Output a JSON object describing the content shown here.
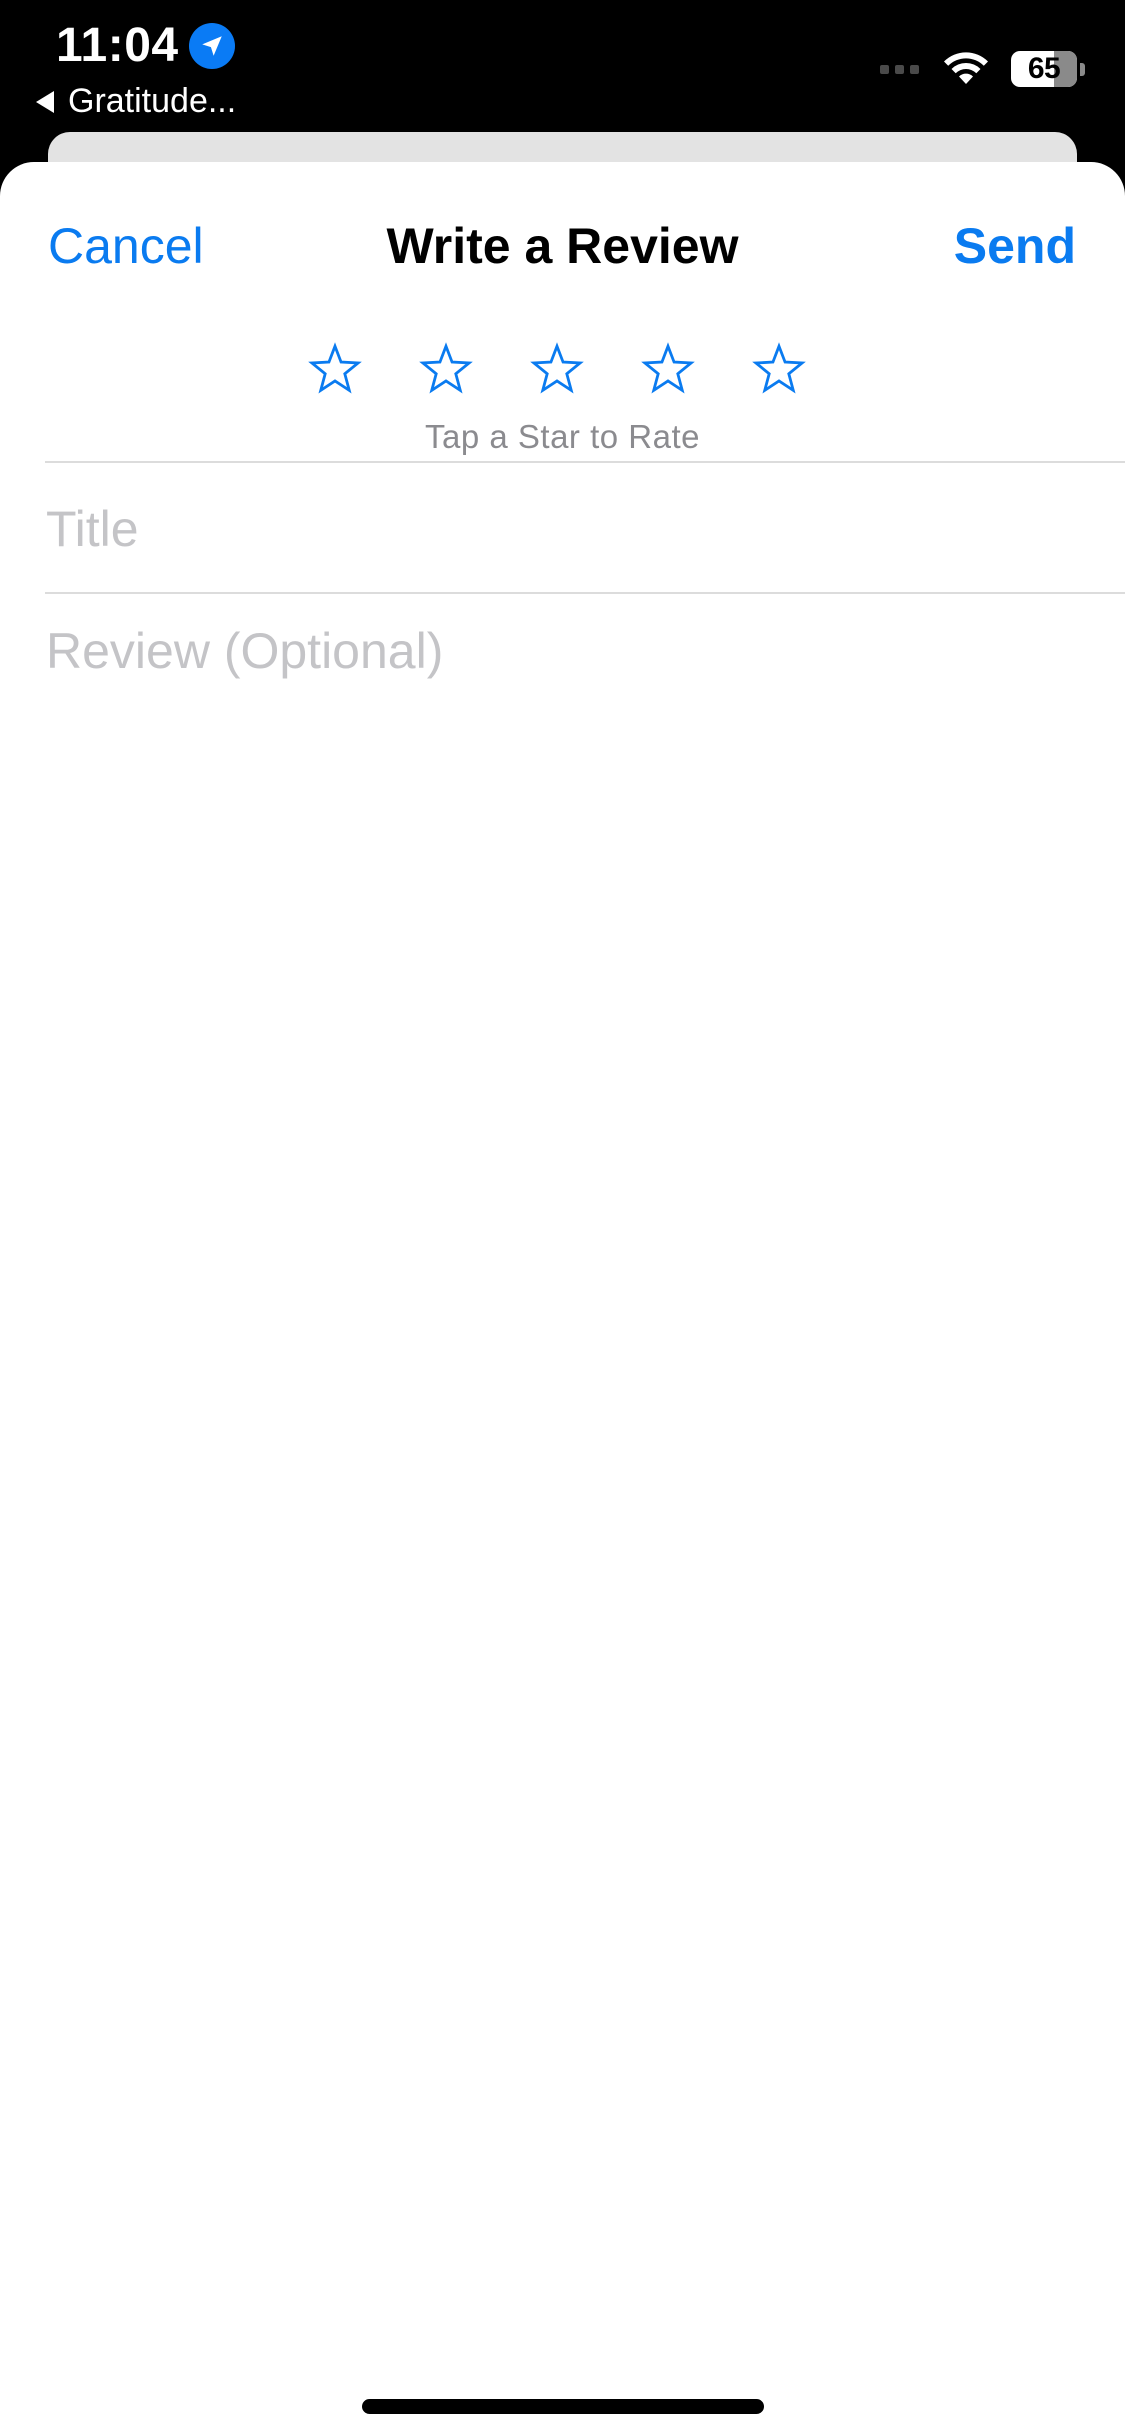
{
  "status_bar": {
    "time": "11:04",
    "back_label": "Gratitude...",
    "battery_level": "65",
    "battery_fraction": 0.65
  },
  "nav": {
    "cancel_label": "Cancel",
    "title": "Write a Review",
    "send_label": "Send"
  },
  "rating": {
    "max_stars": 5,
    "selected": 0,
    "hint": "Tap a Star to Rate"
  },
  "form": {
    "title_placeholder": "Title",
    "title_value": "",
    "review_placeholder": "Review (Optional)",
    "review_value": ""
  },
  "colors": {
    "accent": "#0a7bf0",
    "placeholder": "#c4c4c7",
    "hint": "#8b8b8f"
  },
  "icons": [
    "location-arrow-icon",
    "back-caret-icon",
    "cellular-signal-icon",
    "wifi-icon",
    "battery-icon",
    "star-outline-icon"
  ]
}
